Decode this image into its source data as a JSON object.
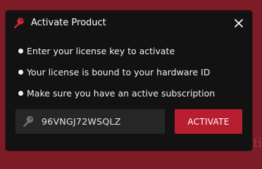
{
  "background": {
    "text": "ti"
  },
  "dialog": {
    "title": "Activate Product",
    "title_icon": "key-icon",
    "close_icon": "close-icon",
    "bullets": [
      {
        "text": "Enter your license key to activate"
      },
      {
        "text": "Your license is bound to your hardware ID"
      },
      {
        "text": "Make sure you have an active subscription"
      }
    ],
    "license_key": {
      "value": "96VNGJ72WSQLZ",
      "icon": "key-icon"
    },
    "activate_button": {
      "label": "ACTIVATE"
    }
  },
  "colors": {
    "background": "#7d1c27",
    "dialog": "#121212",
    "accent": "#b81e30",
    "field": "#262626",
    "text": "#ffffff"
  }
}
